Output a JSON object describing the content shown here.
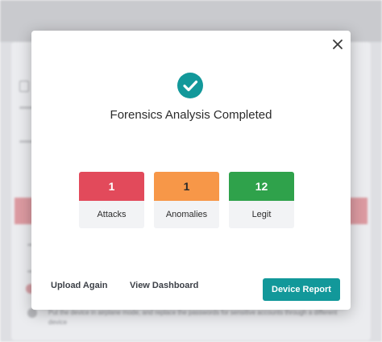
{
  "background": {
    "instruction_line": "Put the device in airplane mode, and replace the passwords for sensitive accounts through a different",
    "instruction_line_2": "device"
  },
  "modal": {
    "title": "Forensics Analysis Completed",
    "icons": {
      "success": "check-circle-icon",
      "close": "close-icon"
    },
    "stats": [
      {
        "value": "1",
        "label": "Attacks",
        "color": "#e24a5b"
      },
      {
        "value": "1",
        "label": "Anomalies",
        "color": "#f79748"
      },
      {
        "value": "12",
        "label": "Legit",
        "color": "#2fa24b"
      }
    ],
    "actions": {
      "upload_again": "Upload Again",
      "view_dashboard": "View Dashboard",
      "device_report": "Device Report"
    },
    "colors": {
      "primary": "#12989a"
    }
  }
}
